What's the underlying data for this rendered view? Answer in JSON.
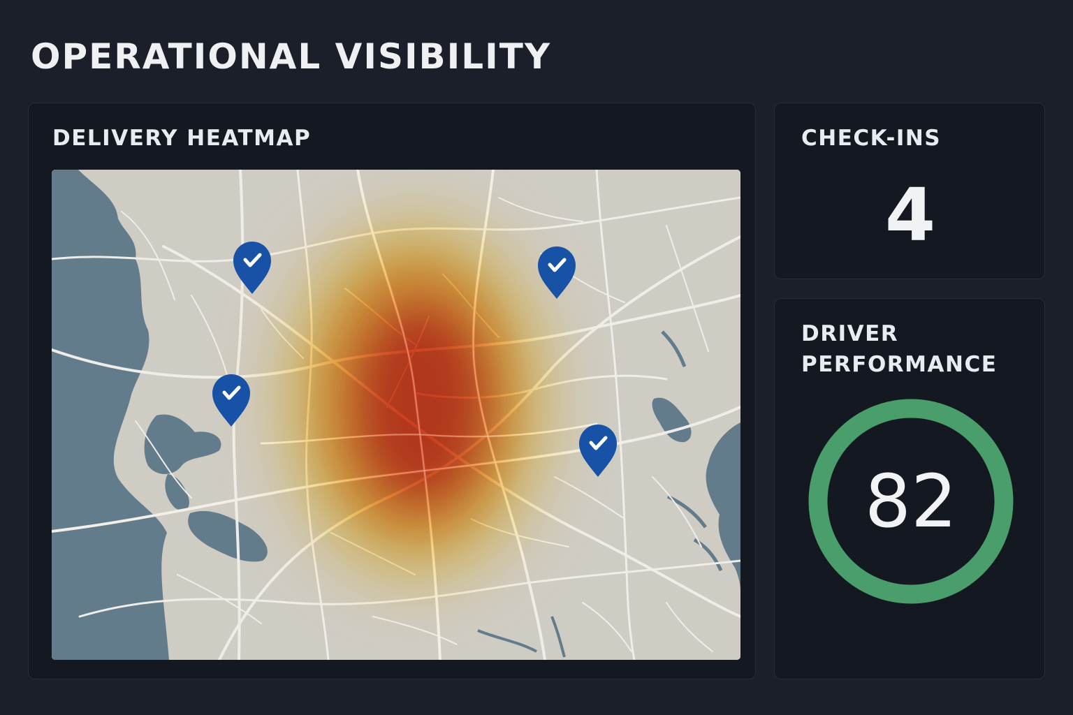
{
  "page": {
    "title": "OPERATIONAL VISIBILITY"
  },
  "heatmap": {
    "title": "DELIVERY HEATMAP",
    "check_in_marker_icon": "map-pin-check-icon",
    "marker_count": 4,
    "colors": {
      "land": "#cfccc4",
      "water": "#637c8c",
      "roads": "#efede8",
      "marker": "#1752a6",
      "heat_low": "#ffdc6e",
      "heat_mid": "#f6a341",
      "heat_high": "#d83c22"
    }
  },
  "checkins": {
    "title": "CHECK-INS",
    "value": "4"
  },
  "driver_performance": {
    "title": "DRIVER PERFORMANCE",
    "value": "82",
    "ring_color": "#4a9e6b"
  }
}
